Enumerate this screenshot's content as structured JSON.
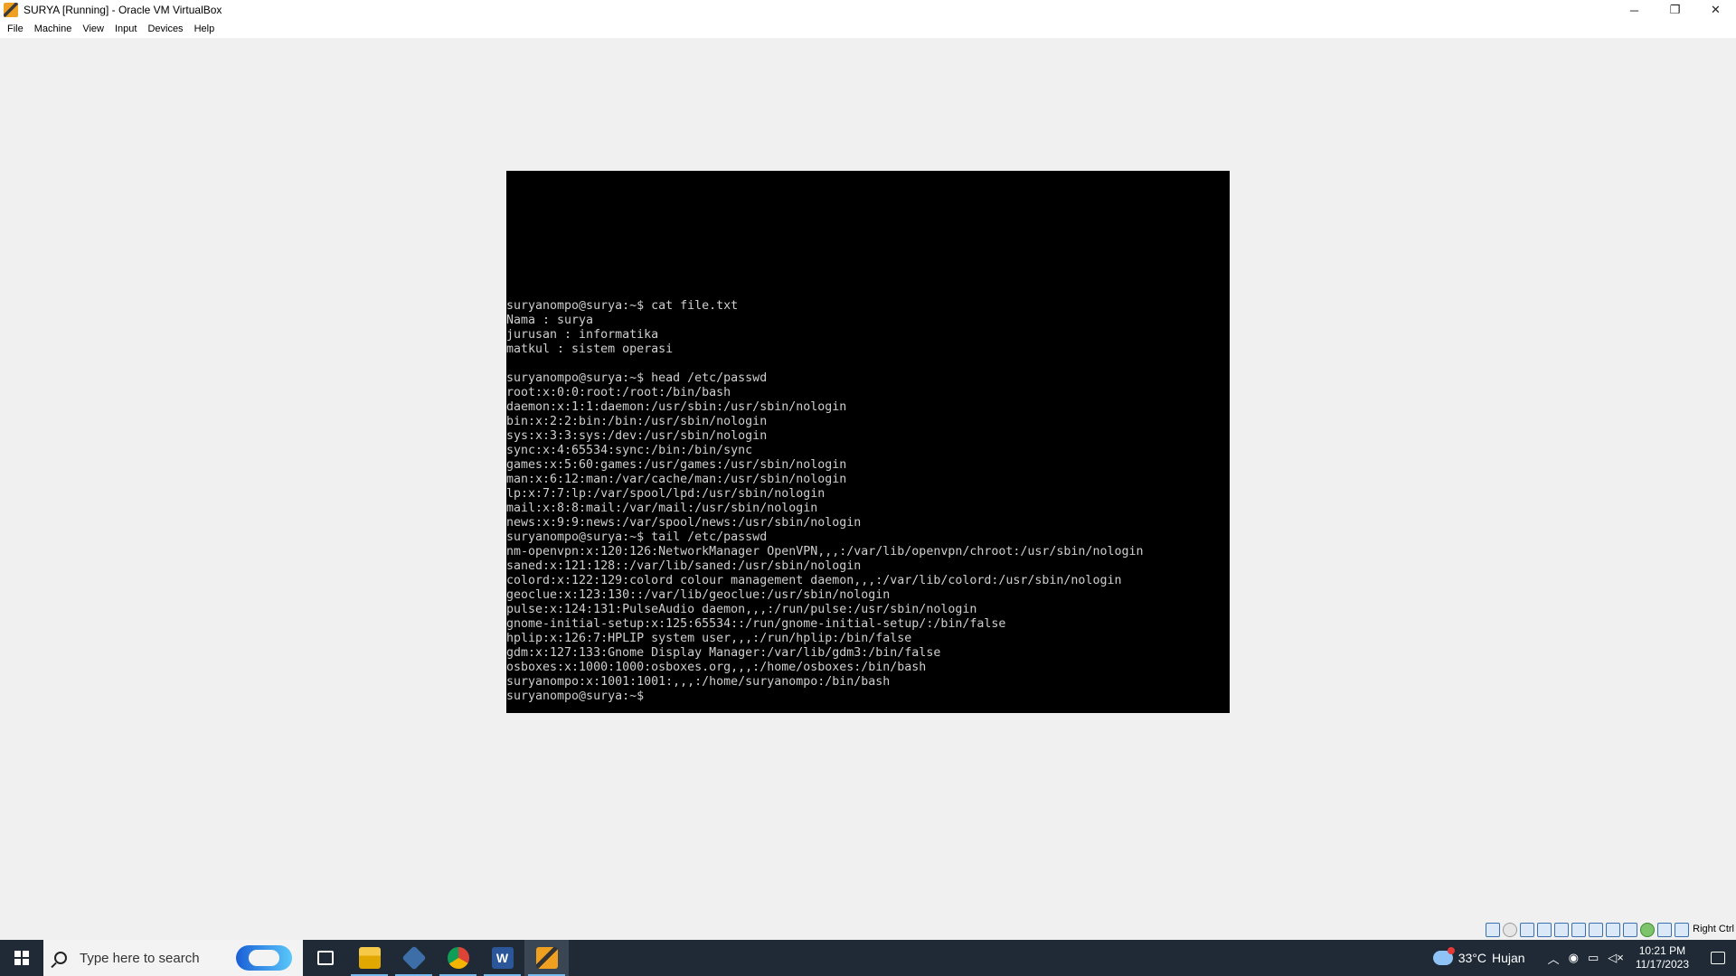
{
  "window": {
    "title": "SURYA [Running] - Oracle VM VirtualBox",
    "minimize_glyph": "─",
    "restore_glyph": "❐",
    "close_glyph": "✕"
  },
  "menu": [
    "File",
    "Machine",
    "View",
    "Input",
    "Devices",
    "Help"
  ],
  "terminal": {
    "lines": [
      "suryanompo@surya:~$ cat file.txt",
      "Nama : surya",
      "jurusan : informatika",
      "matkul : sistem operasi",
      "",
      "suryanompo@surya:~$ head /etc/passwd",
      "root:x:0:0:root:/root:/bin/bash",
      "daemon:x:1:1:daemon:/usr/sbin:/usr/sbin/nologin",
      "bin:x:2:2:bin:/bin:/usr/sbin/nologin",
      "sys:x:3:3:sys:/dev:/usr/sbin/nologin",
      "sync:x:4:65534:sync:/bin:/bin/sync",
      "games:x:5:60:games:/usr/games:/usr/sbin/nologin",
      "man:x:6:12:man:/var/cache/man:/usr/sbin/nologin",
      "lp:x:7:7:lp:/var/spool/lpd:/usr/sbin/nologin",
      "mail:x:8:8:mail:/var/mail:/usr/sbin/nologin",
      "news:x:9:9:news:/var/spool/news:/usr/sbin/nologin",
      "suryanompo@surya:~$ tail /etc/passwd",
      "nm-openvpn:x:120:126:NetworkManager OpenVPN,,,:/var/lib/openvpn/chroot:/usr/sbin/nologin",
      "saned:x:121:128::/var/lib/saned:/usr/sbin/nologin",
      "colord:x:122:129:colord colour management daemon,,,:/var/lib/colord:/usr/sbin/nologin",
      "geoclue:x:123:130::/var/lib/geoclue:/usr/sbin/nologin",
      "pulse:x:124:131:PulseAudio daemon,,,:/run/pulse:/usr/sbin/nologin",
      "gnome-initial-setup:x:125:65534::/run/gnome-initial-setup/:/bin/false",
      "hplip:x:126:7:HPLIP system user,,,:/run/hplip:/bin/false",
      "gdm:x:127:133:Gnome Display Manager:/var/lib/gdm3:/bin/false",
      "osboxes:x:1000:1000:osboxes.org,,,:/home/osboxes:/bin/bash",
      "suryanompo:x:1001:1001:,,,:/home/suryanompo:/bin/bash",
      "suryanompo@surya:~$"
    ]
  },
  "vm_status": {
    "host_key": "Right Ctrl",
    "icons": [
      "hard-disk-icon",
      "optical-drive-icon",
      "audio-icon",
      "network-icon",
      "usb-icon",
      "shared-folders-icon",
      "display-icon",
      "capture-icon",
      "recording-icon",
      "cpu-icon",
      "mouse-integration-icon",
      "keyboard-icon"
    ]
  },
  "taskbar": {
    "search_placeholder": "Type here to search",
    "word_letter": "W",
    "weather_temp": "33°C",
    "weather_desc": "Hujan",
    "time": "10:21 PM",
    "date": "11/17/2023"
  }
}
